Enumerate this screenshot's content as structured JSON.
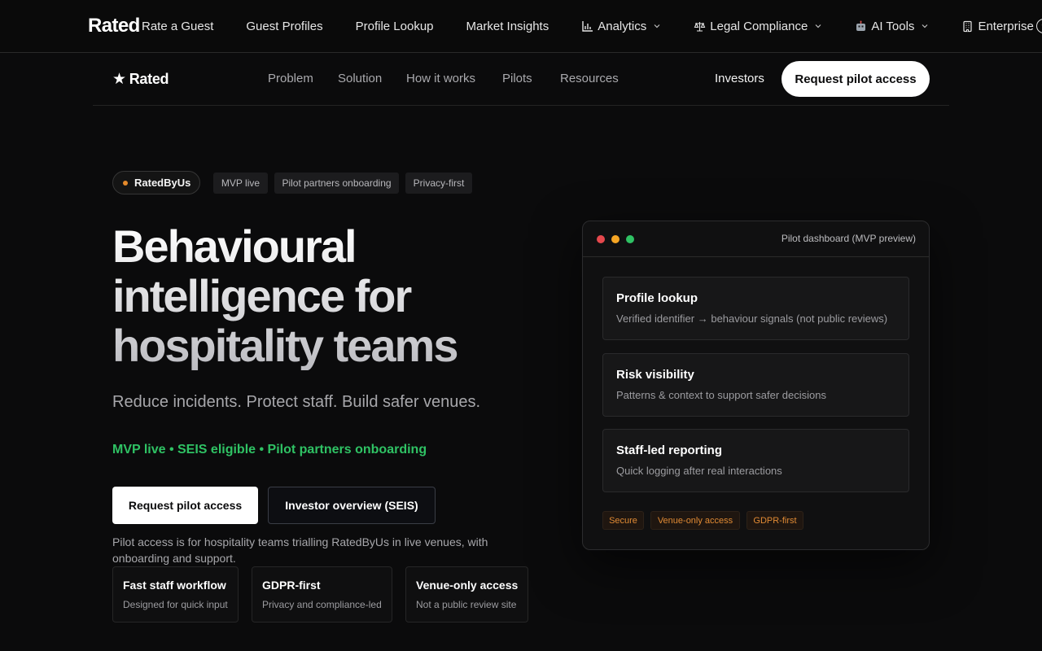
{
  "top_nav": {
    "brand": "Rated",
    "items": [
      {
        "label": "Rate a Guest"
      },
      {
        "label": "Guest Profiles"
      },
      {
        "label": "Profile Lookup"
      },
      {
        "label": "Market Insights"
      },
      {
        "label": "Analytics",
        "icon": "bar-chart-icon",
        "dropdown": true
      },
      {
        "label": "Legal Compliance",
        "icon": "scales-icon",
        "dropdown": true
      },
      {
        "label": "AI Tools",
        "icon": "robot-icon",
        "dropdown": true
      },
      {
        "label": "Enterprise",
        "icon": "building-icon",
        "dropdown": true
      }
    ]
  },
  "sub_nav": {
    "logo_star": "★",
    "logo_text": "Rated",
    "menu": [
      "Problem",
      "Solution",
      "How it works",
      "Pilots",
      "Resources"
    ],
    "investors": "Investors",
    "cta": "Request pilot access"
  },
  "hero": {
    "badge": "RatedByUs",
    "chips": [
      "MVP live",
      "Pilot partners onboarding",
      "Privacy-first"
    ],
    "title_lines": [
      "Behavioural",
      "intelligence for",
      "hospitality teams"
    ],
    "subtitle": "Reduce incidents. Protect staff. Build safer venues.",
    "status": "MVP live • SEIS eligible • Pilot partners onboarding",
    "primary_cta": "Request pilot access",
    "secondary_cta": "Investor overview (SEIS)",
    "note": "Pilot access is for hospitality teams trialling RatedByUs in live venues, with onboarding and support.",
    "features": [
      {
        "title": "Fast staff workflow",
        "desc": "Designed for quick input"
      },
      {
        "title": "GDPR-first",
        "desc": "Privacy and compliance-led"
      },
      {
        "title": "Venue-only access",
        "desc": "Not a public review site"
      }
    ]
  },
  "dashboard": {
    "title": "Pilot dashboard (MVP preview)",
    "window_dot_colors": [
      "#e5484d",
      "#f5a524",
      "#2fc264"
    ],
    "cards": [
      {
        "title": "Profile lookup",
        "desc": "Verified identifier → behaviour signals (not public reviews)"
      },
      {
        "title": "Risk visibility",
        "desc": "Patterns & context to support safer decisions"
      },
      {
        "title": "Staff-led reporting",
        "desc": "Quick logging after real interactions"
      }
    ],
    "tags": [
      "Secure",
      "Venue-only access",
      "GDPR-first"
    ]
  },
  "colors": {
    "accent_green": "#2fc264",
    "accent_orange": "#e08a34",
    "background": "#0b0b0c"
  }
}
